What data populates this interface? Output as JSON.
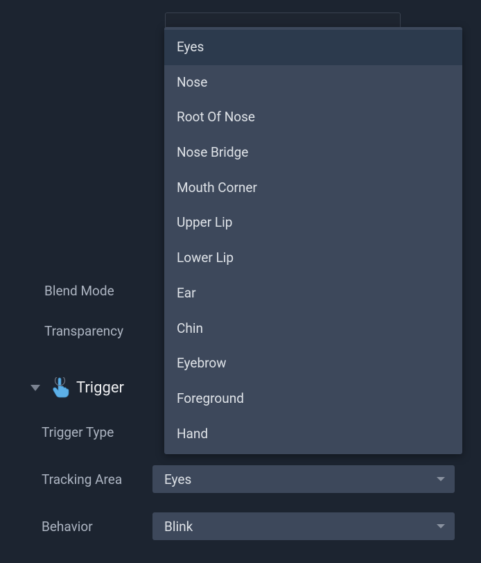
{
  "properties": {
    "blend_mode_label": "Blend Mode",
    "transparency_label": "Transparency"
  },
  "section": {
    "trigger_title": "Trigger"
  },
  "trigger": {
    "type_label": "Trigger Type",
    "tracking_area_label": "Tracking Area",
    "tracking_area_value": "Eyes",
    "behavior_label": "Behavior",
    "behavior_value": "Blink"
  },
  "tracking_area_options": [
    {
      "label": "Eyes",
      "selected": true
    },
    {
      "label": "Nose",
      "selected": false
    },
    {
      "label": "Root Of Nose",
      "selected": false
    },
    {
      "label": "Nose Bridge",
      "selected": false
    },
    {
      "label": "Mouth Corner",
      "selected": false
    },
    {
      "label": "Upper Lip",
      "selected": false
    },
    {
      "label": "Lower Lip",
      "selected": false
    },
    {
      "label": "Ear",
      "selected": false
    },
    {
      "label": "Chin",
      "selected": false
    },
    {
      "label": "Eyebrow",
      "selected": false
    },
    {
      "label": "Foreground",
      "selected": false
    },
    {
      "label": "Hand",
      "selected": false
    }
  ]
}
